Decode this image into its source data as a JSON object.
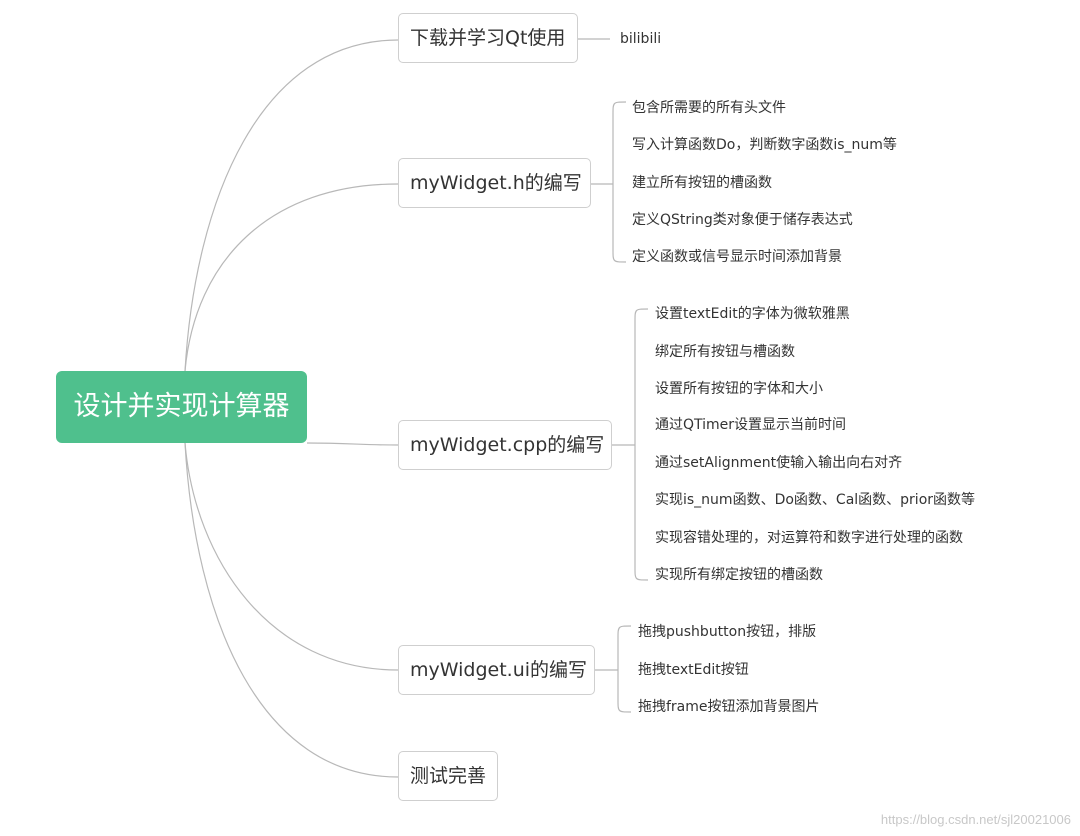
{
  "root": {
    "label": "设计并实现计算器"
  },
  "branches": [
    {
      "label": "下载并学习Qt使用",
      "children": [
        "bilibili"
      ]
    },
    {
      "label": "myWidget.h的编写",
      "children": [
        "包含所需要的所有头文件",
        "写入计算函数Do，判断数字函数is_num等",
        "建立所有按钮的槽函数",
        "定义QString类对象便于储存表达式",
        "定义函数或信号显示时间添加背景"
      ]
    },
    {
      "label": "myWidget.cpp的编写",
      "children": [
        "设置textEdit的字体为微软雅黑",
        "绑定所有按钮与槽函数",
        "设置所有按钮的字体和大小",
        "通过QTimer设置显示当前时间",
        "通过setAlignment使输入输出向右对齐",
        "实现is_num函数、Do函数、Cal函数、prior函数等",
        "实现容错处理的，对运算符和数字进行处理的函数",
        "实现所有绑定按钮的槽函数"
      ]
    },
    {
      "label": "myWidget.ui的编写",
      "children": [
        "拖拽pushbutton按钮，排版",
        "拖拽textEdit按钮",
        "拖拽frame按钮添加背景图片"
      ]
    },
    {
      "label": "测试完善",
      "children": []
    }
  ],
  "watermark": "https://blog.csdn.net/sjl20021006",
  "colors": {
    "root_fill": "#4fc08d",
    "connector": "#b8b8b8",
    "node_border": "#cfcfcf"
  }
}
